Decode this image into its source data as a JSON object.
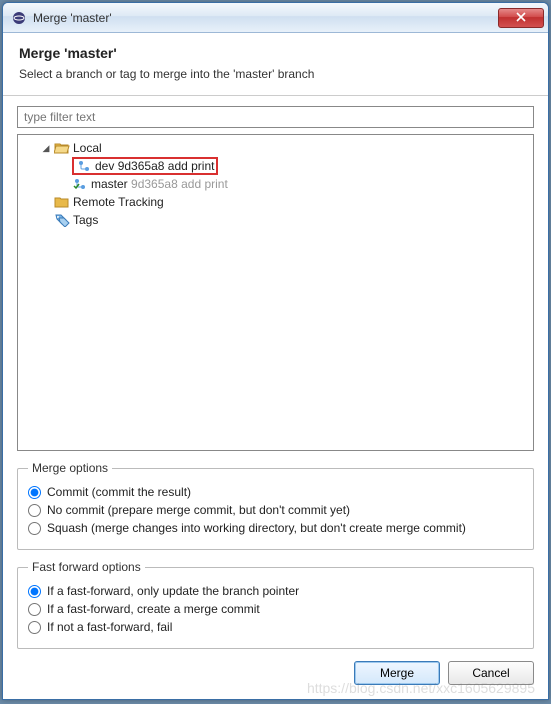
{
  "window": {
    "title": "Merge 'master'"
  },
  "header": {
    "title": "Merge 'master'",
    "subtitle": "Select a branch or tag to merge into the 'master' branch"
  },
  "filter": {
    "placeholder": "type filter text",
    "value": ""
  },
  "tree": {
    "local": {
      "label": "Local",
      "branches": [
        {
          "name": "dev",
          "hash": "9d365a8",
          "message": "add print",
          "selected": true
        },
        {
          "name": "master",
          "hash": "9d365a8",
          "message": "add print",
          "selected": false
        }
      ]
    },
    "remote": {
      "label": "Remote Tracking"
    },
    "tags": {
      "label": "Tags"
    }
  },
  "mergeOptions": {
    "legend": "Merge options",
    "items": [
      {
        "label": "Commit (commit the result)",
        "checked": true
      },
      {
        "label": "No commit (prepare merge commit, but don't commit yet)",
        "checked": false
      },
      {
        "label": "Squash (merge changes into working directory, but don't create merge commit)",
        "checked": false
      }
    ]
  },
  "ffOptions": {
    "legend": "Fast forward options",
    "items": [
      {
        "label": "If a fast-forward, only update the branch pointer",
        "checked": true
      },
      {
        "label": "If a fast-forward, create a merge commit",
        "checked": false
      },
      {
        "label": "If not a fast-forward, fail",
        "checked": false
      }
    ]
  },
  "buttons": {
    "merge": "Merge",
    "cancel": "Cancel"
  },
  "watermark": "https://blog.csdn.net/xxc1605629895"
}
